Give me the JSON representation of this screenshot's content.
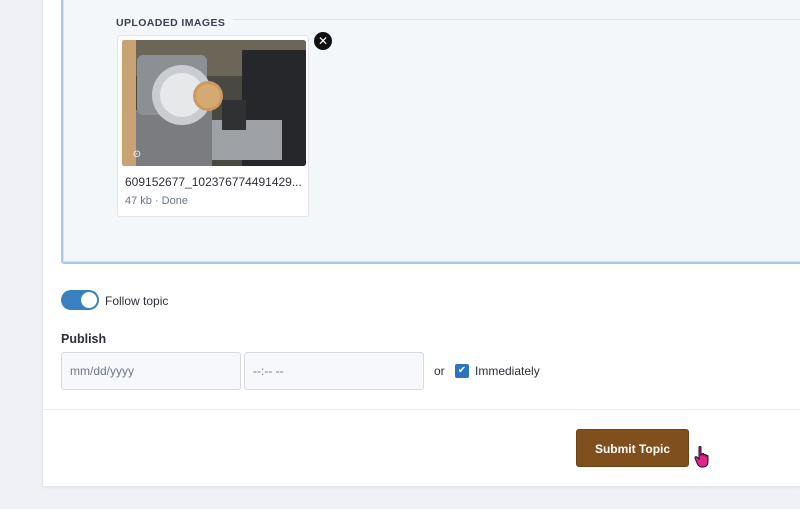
{
  "uploads": {
    "section_title": "UPLOADED IMAGES",
    "files": [
      {
        "name": "609152677_102376774491429...",
        "size": "47 kb",
        "status": "Done",
        "meta": "47 kb · Done",
        "remove_icon": "close-icon",
        "preview_badge_icon": "image-preview-icon"
      }
    ]
  },
  "follow": {
    "label": "Follow topic",
    "enabled": true
  },
  "publish": {
    "label": "Publish",
    "date_placeholder": "mm/dd/yyyy",
    "time_placeholder": "--:-- --",
    "or_label": "or",
    "immediately_label": "Immediately",
    "immediately_checked": true
  },
  "actions": {
    "submit_label": "Submit Topic"
  },
  "colors": {
    "accent": "#3a7fc1",
    "submit": "#7f4f1d",
    "upload_border": "#a9c7e6"
  }
}
